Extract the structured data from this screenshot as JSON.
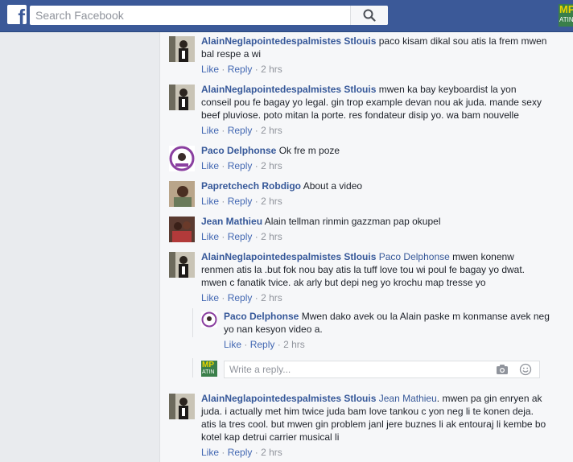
{
  "header": {
    "logo": "f",
    "search_placeholder": "Search Facebook",
    "corner_thumb_text": "MP",
    "corner_thumb_sub": "ATIN"
  },
  "comments": [
    {
      "author": "AlainNeglapointedespalmistes Stlouis",
      "tag": "",
      "text": "paco kisam dikal sou atis la frem mwen bal respe a wi",
      "like": "Like",
      "reply": "Reply",
      "time": "2 hrs"
    },
    {
      "author": "AlainNeglapointedespalmistes Stlouis",
      "tag": "",
      "text": "mwen ka bay keyboardist la yon conseil pou fe bagay yo legal. gin trop example devan nou ak juda. mande sexy beef pluviose. poto mitan la porte. res fondateur disip yo. wa bam nouvelle",
      "like": "Like",
      "reply": "Reply",
      "time": "2 hrs"
    },
    {
      "author": "Paco Delphonse",
      "tag": "",
      "text": "Ok fre m poze",
      "like": "Like",
      "reply": "Reply",
      "time": "2 hrs"
    },
    {
      "author": "Papretchech Robdigo",
      "tag": "",
      "text": "About a video",
      "like": "Like",
      "reply": "Reply",
      "time": "2 hrs"
    },
    {
      "author": "Jean Mathieu",
      "tag": "",
      "text": "Alain tellman rinmin gazzman pap okupel",
      "like": "Like",
      "reply": "Reply",
      "time": "2 hrs"
    },
    {
      "author": "AlainNeglapointedespalmistes Stlouis",
      "tag": "Paco Delphonse",
      "text": "mwen konenw renmen atis la .but fok nou bay atis la tuff love tou wi poul fe bagay yo dwat. mwen c fanatik tvice. ak arly but depi neg yo krochu map tresse yo",
      "like": "Like",
      "reply": "Reply",
      "time": "2 hrs"
    },
    {
      "author": "AlainNeglapointedespalmistes Stlouis",
      "tag": "Jean Mathieu",
      "text": ". mwen pa gin enryen ak juda. i actually met him twice juda bam love tankou c yon neg li te konen deja. atis la tres cool. but mwen gin problem janl jere buznes li ak entouraj li kembe bo kotel kap detrui carrier musical li",
      "like": "Like",
      "reply": "Reply",
      "time": "2 hrs"
    }
  ],
  "nested_reply": {
    "author": "Paco Delphonse",
    "text": "Mwen dako avek ou la Alain paske m konmanse avek neg yo nan kesyon video a.",
    "like": "Like",
    "reply": "Reply",
    "time": "2 hrs"
  },
  "reply_box": {
    "placeholder": "Write a reply...",
    "avatar_text": "MP",
    "avatar_sub": "ATIN"
  },
  "separator": "·",
  "colors": {
    "brand": "#3b5998",
    "link": "#365899",
    "meta": "#90949c"
  }
}
